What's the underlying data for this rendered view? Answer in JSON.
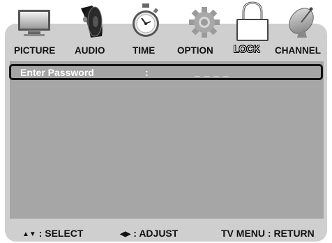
{
  "menu": {
    "tabs": [
      {
        "label": "PICTURE",
        "icon": "monitor-icon"
      },
      {
        "label": "AUDIO",
        "icon": "speaker-icon"
      },
      {
        "label": "TIME",
        "icon": "stopwatch-icon"
      },
      {
        "label": "OPTION",
        "icon": "gear-icon"
      },
      {
        "label": "LOCK",
        "icon": "padlock-icon",
        "active": true
      },
      {
        "label": "CHANNEL",
        "icon": "satellite-dish-icon"
      }
    ]
  },
  "lock": {
    "password_label": "Enter Password",
    "separator": ":",
    "password_value": "_ _ _ _"
  },
  "footer": {
    "select_glyph": "▲▼",
    "select_text": " : SELECT",
    "adjust_glyph": "◀▶",
    "adjust_text": " : ADJUST",
    "return_text": "TV MENU : RETURN"
  },
  "colors": {
    "panel": "#cfcfcf",
    "content": "#a6a6a6",
    "highlight_border": "#121212",
    "text_light": "#ffffff",
    "text_dark": "#111111"
  }
}
